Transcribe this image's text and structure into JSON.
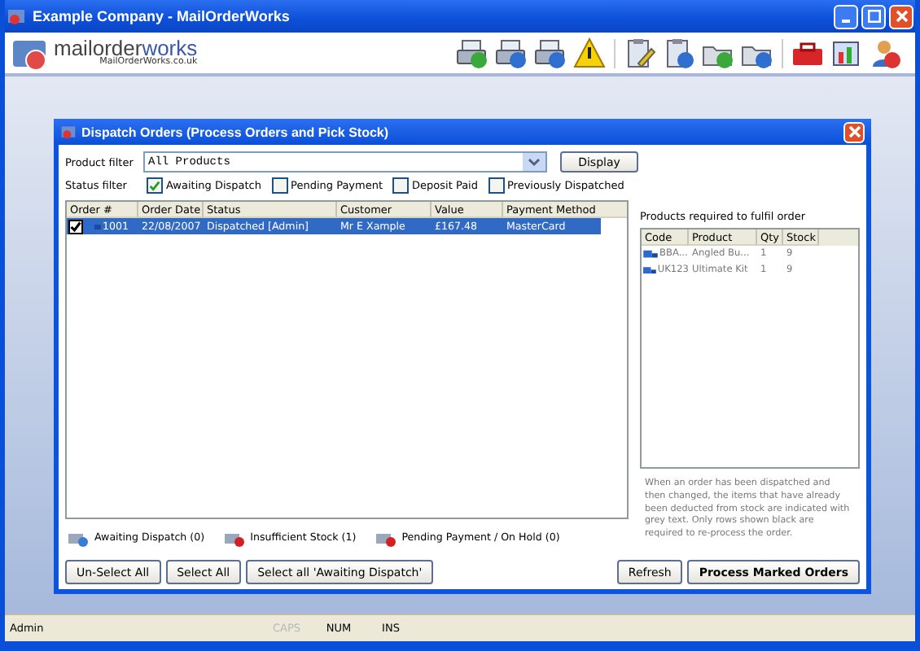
{
  "window": {
    "title": "Example Company - MailOrderWorks"
  },
  "logo": {
    "name_a": "mailorder",
    "name_b": "works",
    "url": "MailOrderWorks.co.uk"
  },
  "dialog": {
    "title": "Dispatch Orders  (Process Orders and Pick Stock)",
    "product_filter": {
      "label": "Product filter",
      "value": "All Products",
      "button": "Display"
    },
    "status_filter": {
      "label": "Status filter",
      "options": [
        {
          "label": "Awaiting Dispatch",
          "checked": true
        },
        {
          "label": "Pending Payment",
          "checked": false
        },
        {
          "label": "Deposit Paid",
          "checked": false
        },
        {
          "label": "Previously Dispatched",
          "checked": false
        }
      ]
    },
    "orders": {
      "columns": [
        "Order #",
        "Order Date",
        "Status",
        "Customer",
        "Value",
        "Payment Method"
      ],
      "rows": [
        {
          "checked": true,
          "selected": true,
          "cells": [
            "1001",
            "22/08/2007",
            "Dispatched [Admin]",
            "Mr E Xample",
            "£167.48",
            "MasterCard"
          ]
        }
      ]
    },
    "products": {
      "title": "Products required to fulfil order",
      "columns": [
        "Code",
        "Product",
        "Qty",
        "Stock"
      ],
      "rows": [
        {
          "cells": [
            "BBA...",
            "Angled Bu...",
            "1",
            "9"
          ]
        },
        {
          "cells": [
            "UK123",
            "Ultimate Kit",
            "1",
            "9"
          ]
        }
      ]
    },
    "note": "When an order has been dispatched and then changed, the items that have already been deducted from stock are indicated with grey text. Only rows shown black are required to re-process the order.",
    "legend": [
      {
        "label": "Awaiting Dispatch (0)",
        "color": "#3a7bd5"
      },
      {
        "label": "Insufficient Stock (1)",
        "color": "#d42020"
      },
      {
        "label": "Pending Payment / On Hold (0)",
        "color": "#d42020"
      }
    ],
    "left_buttons": [
      "Un-Select All",
      "Select All",
      "Select all 'Awaiting Dispatch'"
    ],
    "right_buttons": [
      {
        "label": "Refresh",
        "kind": "normal"
      },
      {
        "label": "Process Marked Orders",
        "kind": "bold"
      }
    ]
  },
  "status_bar": {
    "user": "Admin",
    "indicators": [
      {
        "label": "CAPS",
        "on": false
      },
      {
        "label": "NUM",
        "on": true
      },
      {
        "label": "INS",
        "on": true
      }
    ]
  }
}
